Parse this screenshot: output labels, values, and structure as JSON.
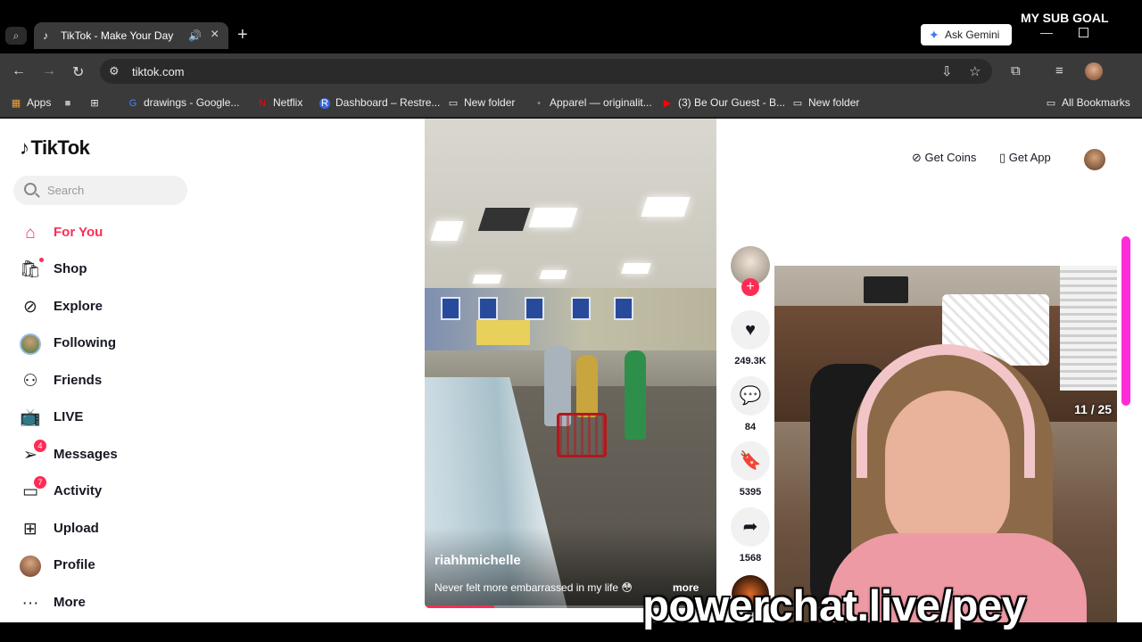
{
  "browser": {
    "tab": {
      "title": "TikTok - Make Your Day"
    },
    "gemini_label": "Ask Gemini",
    "url": "tiktok.com",
    "bookmarks": [
      "Apps",
      "drawings - Google...",
      "Netflix",
      "Dashboard – Restre...",
      "New folder",
      "Apparel — originalit...",
      "(3) Be Our Guest - B...",
      "New folder",
      "All Bookmarks"
    ]
  },
  "stream_overlay": {
    "sub_goal": "MY SUB GOAL",
    "counter": "11 / 25",
    "url": "powerchat.live/pey"
  },
  "tiktok": {
    "logo": "TikTok",
    "search_placeholder": "Search",
    "nav": [
      {
        "label": "For You",
        "icon": "home-icon",
        "active": true
      },
      {
        "label": "Shop",
        "icon": "shopping-bag-icon"
      },
      {
        "label": "Explore",
        "icon": "compass-icon"
      },
      {
        "label": "Following",
        "icon": "following-avatar-icon"
      },
      {
        "label": "Friends",
        "icon": "friends-icon"
      },
      {
        "label": "LIVE",
        "icon": "live-tv-icon"
      },
      {
        "label": "Messages",
        "icon": "send-icon",
        "badge": "4"
      },
      {
        "label": "Activity",
        "icon": "activity-icon",
        "badge": "7"
      },
      {
        "label": "Upload",
        "icon": "upload-plus-icon"
      },
      {
        "label": "Profile",
        "icon": "profile-avatar-icon"
      },
      {
        "label": "More",
        "icon": "more-dots-icon"
      }
    ],
    "header": {
      "get_coins": "Get Coins",
      "get_app": "Get App"
    },
    "video": {
      "author": "riahhmichelle",
      "caption": "Never felt more embarrassed in my life 😳",
      "more": "more",
      "progress": 0.24
    },
    "actions": {
      "likes": "249.3K",
      "comments": "84",
      "saves": "5395",
      "shares": "1568"
    }
  },
  "colors": {
    "accent": "#fe2c55",
    "scroll_accent": "#ff2bd6"
  }
}
